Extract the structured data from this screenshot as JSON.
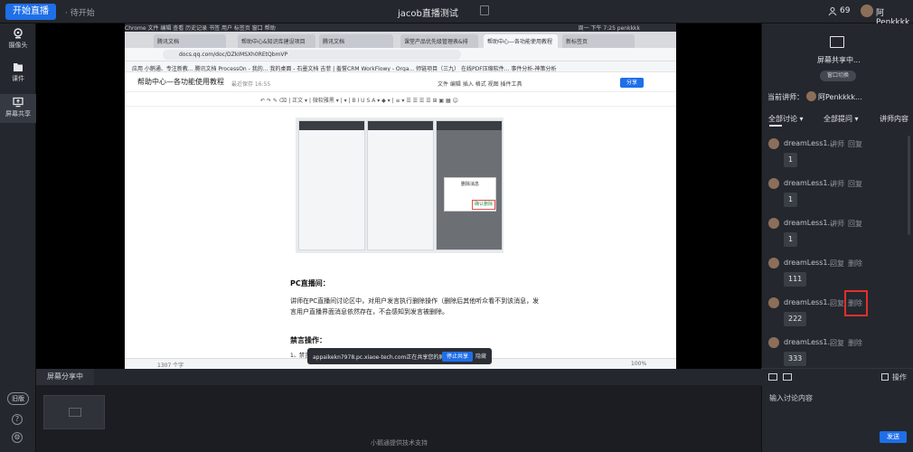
{
  "topbar": {
    "start_live": "开始直播",
    "state": "· 待开始",
    "title": "jacob直播测试",
    "viewers": "69",
    "user": "阿Penkkkk..."
  },
  "leftbar": {
    "camera": "摄像头",
    "courseware": "课件",
    "screen_share": "屏幕共享",
    "old_version": "旧版",
    "help": "?",
    "settings": "⚙"
  },
  "browser": {
    "mac_menu": "  Chrome   文件   编辑   查看   历史记录   书签   用户   标签页   窗口   帮助",
    "mac_status": "周一 下午 7:25   penkkkk",
    "tabs": [
      "腾讯文档",
      "帮助中心&知识库建设项目",
      "腾讯文档",
      "课堂产品优先级管理表&排",
      "帮助中心—各功能使用教程",
      "新标签页"
    ],
    "url": "docs.qq.com/doc/DZkIMSXh0REtQbmVP",
    "bookmarks": "应用   小鹅通、专注新教...   腾讯文档   ProcessOn - 我的...   我的桌面 - 石墨文档   吉菲 | 羞誓CRM   WorkFlowy - Orga...   师链项目（三九）   在线PDF压缩软件...   事件分析-神策分析"
  },
  "doc": {
    "title": "帮助中心—各功能使用教程",
    "saved": "最近保存 16:55",
    "menu": "文件    编辑    插入    格式    视图    插件工具",
    "share": "分享",
    "format_toolbar": "↶  ↷  ✎  ⌫  |  正文 ▾  |  微软雅黑 ▾  |  ▾  |  B   I   U   S   A ▾   ◆ ▾  |  ≡ ▾  ☰  ☰  ☰  ☰  ⊞  ▣  ▦  ☺",
    "section_pc": "PC直播间：",
    "para1": "讲师在PC直播间讨论区中，对用户发言执行删除操作（删除后其他听众看不到该消息，发",
    "para2": "言用户直播界面消息依然存在，不会感知到发言被删除。",
    "section_mute": "禁言操作：",
    "list1": "1、禁言",
    "wordcount": "1307 个字",
    "zoom": "100%",
    "dialog_title": "删除消息",
    "dialog_confirm": "确认删除"
  },
  "share_banner": {
    "text": "appaikekn7978.pc.xiaoe-tech.com正在共享您的屏幕。",
    "stop": "停止共享",
    "hide": "隐藏"
  },
  "bottom": {
    "tab": "屏幕分享中",
    "powered": "小鹅通提供技术支持"
  },
  "right": {
    "share_title": "屏幕共享中...",
    "switch_window": "窗口切换",
    "lecturer_label": "当前讲师：",
    "lecturer_name": "阿Penkkkk...",
    "tabs": [
      "全部讨论 ▾",
      "全部提问 ▾",
      "讲师内容"
    ],
    "messages": [
      {
        "name": "dreamLess1...",
        "a1": "讲师",
        "a2": "回复",
        "content": "1"
      },
      {
        "name": "dreamLess1...",
        "a1": "讲师",
        "a2": "回复",
        "content": "1"
      },
      {
        "name": "dreamLess1...",
        "a1": "讲师",
        "a2": "回复",
        "content": "1"
      },
      {
        "name": "dreamLess1...",
        "a1": "回复",
        "a2": "删除",
        "content": "111"
      },
      {
        "name": "dreamLess1...",
        "a1": "回复",
        "a2": "删除",
        "content": "222"
      },
      {
        "name": "dreamLess1...",
        "a1": "回复",
        "a2": "删除",
        "content": "333"
      }
    ],
    "operate": "操作",
    "input_placeholder": "输入讨论内容",
    "send": "发送"
  },
  "colors": {
    "accent": "#1e6fe8",
    "highlight": "#e0312b",
    "panel": "#24272d"
  }
}
